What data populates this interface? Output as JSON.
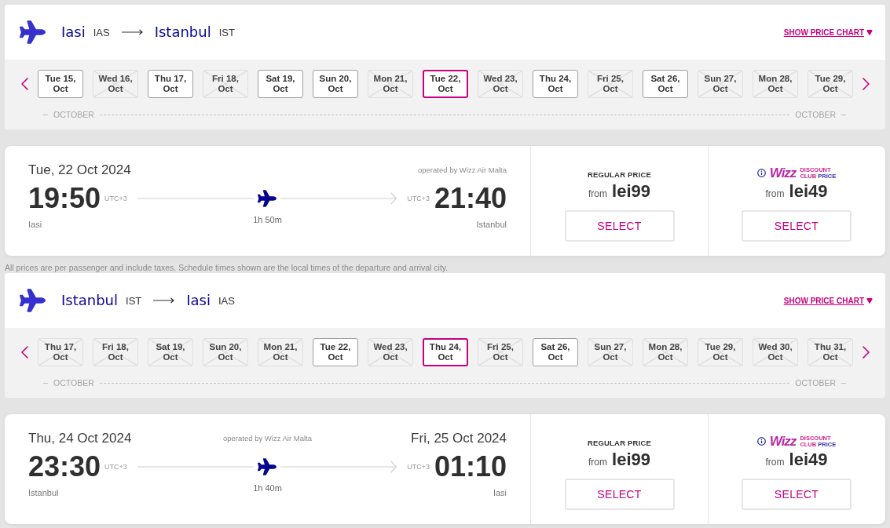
{
  "outbound": {
    "origin": {
      "city": "Iasi",
      "code": "IAS"
    },
    "destination": {
      "city": "Istanbul",
      "code": "IST"
    },
    "price_chart_link": "SHOW PRICE CHART",
    "dates": [
      {
        "day": "Tue 15,",
        "month": "Oct",
        "available": true,
        "selected": false
      },
      {
        "day": "Wed 16,",
        "month": "Oct",
        "available": false,
        "selected": false
      },
      {
        "day": "Thu 17,",
        "month": "Oct",
        "available": true,
        "selected": false
      },
      {
        "day": "Fri 18,",
        "month": "Oct",
        "available": false,
        "selected": false
      },
      {
        "day": "Sat 19,",
        "month": "Oct",
        "available": true,
        "selected": false
      },
      {
        "day": "Sun 20,",
        "month": "Oct",
        "available": true,
        "selected": false
      },
      {
        "day": "Mon 21,",
        "month": "Oct",
        "available": false,
        "selected": false
      },
      {
        "day": "Tue 22,",
        "month": "Oct",
        "available": true,
        "selected": true
      },
      {
        "day": "Wed 23,",
        "month": "Oct",
        "available": false,
        "selected": false
      },
      {
        "day": "Thu 24,",
        "month": "Oct",
        "available": true,
        "selected": false
      },
      {
        "day": "Fri 25,",
        "month": "Oct",
        "available": false,
        "selected": false
      },
      {
        "day": "Sat 26,",
        "month": "Oct",
        "available": true,
        "selected": false
      },
      {
        "day": "Sun 27,",
        "month": "Oct",
        "available": false,
        "selected": false
      },
      {
        "day": "Mon 28,",
        "month": "Oct",
        "available": false,
        "selected": false
      },
      {
        "day": "Tue 29,",
        "month": "Oct",
        "available": false,
        "selected": false
      }
    ],
    "month_labels": [
      "OCTOBER",
      "OCTOBER"
    ],
    "flight": {
      "departure_date": "Tue, 22 Oct 2024",
      "operator": "operated by Wizz Air Malta",
      "departure_time": "19:50",
      "departure_utc": "UTC+3",
      "departure_city": "Iasi",
      "duration": "1h 50m",
      "arrival_utc": "UTC+3",
      "arrival_time": "21:40",
      "arrival_city": "Istanbul",
      "fares": [
        {
          "kind": "regular",
          "title": "REGULAR PRICE",
          "prefix": "from",
          "price": "lei99",
          "button": "SELECT"
        },
        {
          "kind": "club",
          "logo": "Wizz",
          "tagline": "DISCOUNT",
          "tagline_words": [
            "CLUB",
            "PRICE"
          ],
          "prefix": "from",
          "price": "lei49",
          "button": "SELECT"
        }
      ]
    }
  },
  "disclaimer": "All prices are per passenger and include taxes. Schedule times shown are the local times of the departure and arrival city.",
  "return": {
    "origin": {
      "city": "Istanbul",
      "code": "IST"
    },
    "destination": {
      "city": "Iasi",
      "code": "IAS"
    },
    "price_chart_link": "SHOW PRICE CHART",
    "dates": [
      {
        "day": "Thu 17,",
        "month": "Oct",
        "available": false,
        "selected": false
      },
      {
        "day": "Fri 18,",
        "month": "Oct",
        "available": false,
        "selected": false
      },
      {
        "day": "Sat 19,",
        "month": "Oct",
        "available": false,
        "selected": false
      },
      {
        "day": "Sun 20,",
        "month": "Oct",
        "available": false,
        "selected": false
      },
      {
        "day": "Mon 21,",
        "month": "Oct",
        "available": false,
        "selected": false
      },
      {
        "day": "Tue 22,",
        "month": "Oct",
        "available": true,
        "selected": false
      },
      {
        "day": "Wed 23,",
        "month": "Oct",
        "available": false,
        "selected": false
      },
      {
        "day": "Thu 24,",
        "month": "Oct",
        "available": true,
        "selected": true
      },
      {
        "day": "Fri 25,",
        "month": "Oct",
        "available": false,
        "selected": false
      },
      {
        "day": "Sat 26,",
        "month": "Oct",
        "available": true,
        "selected": false
      },
      {
        "day": "Sun 27,",
        "month": "Oct",
        "available": false,
        "selected": false
      },
      {
        "day": "Mon 28,",
        "month": "Oct",
        "available": false,
        "selected": false
      },
      {
        "day": "Tue 29,",
        "month": "Oct",
        "available": false,
        "selected": false
      },
      {
        "day": "Wed 30,",
        "month": "Oct",
        "available": false,
        "selected": false
      },
      {
        "day": "Thu 31,",
        "month": "Oct",
        "available": false,
        "selected": false
      }
    ],
    "month_labels": [
      "OCTOBER",
      "OCTOBER"
    ],
    "flight": {
      "departure_date": "Thu, 24 Oct 2024",
      "operator": "operated by Wizz Air Malta",
      "arrival_date": "Fri, 25 Oct 2024",
      "departure_time": "23:30",
      "departure_utc": "UTC+3",
      "departure_city": "Istanbul",
      "duration": "1h 40m",
      "arrival_utc": "UTC+3",
      "arrival_time": "01:10",
      "arrival_city": "Iasi",
      "fares": [
        {
          "kind": "regular",
          "title": "REGULAR PRICE",
          "prefix": "from",
          "price": "lei99",
          "button": "SELECT"
        },
        {
          "kind": "club",
          "logo": "Wizz",
          "tagline": "DISCOUNT",
          "tagline_words": [
            "CLUB",
            "PRICE"
          ],
          "prefix": "from",
          "price": "lei49",
          "button": "SELECT"
        }
      ]
    }
  }
}
